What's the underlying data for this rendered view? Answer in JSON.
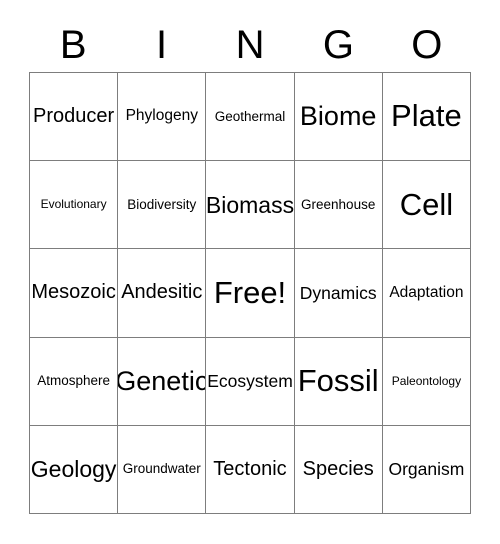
{
  "card": {
    "title": "BINGO",
    "header_letters": [
      "B",
      "I",
      "N",
      "G",
      "O"
    ],
    "grid_size": "5x5",
    "free_space": "Free!",
    "colors": {
      "background": "#ffffff",
      "text": "#000000",
      "grid_line": "#7d7d7d"
    },
    "rows": [
      [
        {
          "label": "Producer",
          "size": "xl"
        },
        {
          "label": "Phylogeny",
          "size": "m"
        },
        {
          "label": "Geothermal",
          "size": "s"
        },
        {
          "label": "Biome",
          "size": "xxxl"
        },
        {
          "label": "Plate",
          "size": "huge"
        }
      ],
      [
        {
          "label": "Evolutionary",
          "size": "xs"
        },
        {
          "label": "Biodiversity",
          "size": "s"
        },
        {
          "label": "Biomass",
          "size": "xxl"
        },
        {
          "label": "Greenhouse",
          "size": "s"
        },
        {
          "label": "Cell",
          "size": "huge"
        }
      ],
      [
        {
          "label": "Mesozoic",
          "size": "xl"
        },
        {
          "label": "Andesitic",
          "size": "xl"
        },
        {
          "label": "Free!",
          "size": "huge"
        },
        {
          "label": "Dynamics",
          "size": "l"
        },
        {
          "label": "Adaptation",
          "size": "m"
        }
      ],
      [
        {
          "label": "Atmosphere",
          "size": "s"
        },
        {
          "label": "Genetic",
          "size": "xxxl"
        },
        {
          "label": "Ecosystem",
          "size": "l"
        },
        {
          "label": "Fossil",
          "size": "huge"
        },
        {
          "label": "Paleontology",
          "size": "xs"
        }
      ],
      [
        {
          "label": "Geology",
          "size": "xxl"
        },
        {
          "label": "Groundwater",
          "size": "s"
        },
        {
          "label": "Tectonic",
          "size": "xl"
        },
        {
          "label": "Species",
          "size": "xl"
        },
        {
          "label": "Organism",
          "size": "l"
        }
      ]
    ]
  }
}
